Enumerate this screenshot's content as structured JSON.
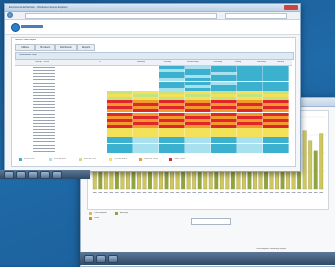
{
  "front_window": {
    "title": "Environmental Monitor - Windows Internet Explorer",
    "tabs": [
      "Utilities",
      "Hot Alerts",
      "Distribution",
      "Reports"
    ],
    "panel_title": "Utilities Profile Report",
    "header_caption": "Performance view",
    "grid_headers": [
      "Group / Circuit",
      "%",
      "Monday",
      "Tuesday",
      "Wednesday",
      "Thursday",
      "Friday",
      "Saturday",
      "Sunday"
    ],
    "legend": [
      "0% to 25%",
      "25% to 50%",
      "50% to 75%",
      "75% to 100%",
      "100% to 125%",
      "Over 125%"
    ],
    "legend_colors": [
      "#3cb0cf",
      "#a7e0ee",
      "#c6e27a",
      "#f4e15a",
      "#f39a2c",
      "#e0262b"
    ]
  },
  "back_window": {
    "title": "Consumption Chart",
    "subtitle": "Consumption Summary Report",
    "chart_values": [
      34,
      68,
      72,
      40,
      78,
      82,
      60,
      74,
      88,
      70,
      52,
      80,
      86,
      64,
      76,
      90,
      58,
      72,
      84,
      66,
      48,
      79,
      85,
      61,
      73,
      87,
      55,
      70,
      82,
      63,
      45,
      76,
      88,
      59,
      74,
      85,
      60,
      69,
      81,
      67,
      53,
      77
    ],
    "legend": [
      "Consumption",
      "Average",
      "Peak"
    ],
    "footer_text": "Consumption Summary Report"
  },
  "taskbar": {
    "items": [
      "start",
      "ie",
      "explorer",
      "media",
      "word"
    ]
  }
}
